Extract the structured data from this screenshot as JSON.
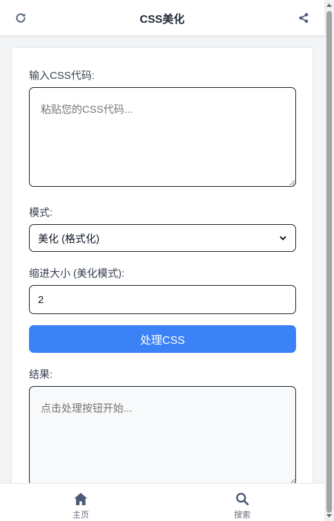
{
  "header": {
    "title": "CSS美化",
    "refresh_icon": "refresh-icon",
    "share_icon": "share-icon"
  },
  "form": {
    "input_label": "输入CSS代码:",
    "input_placeholder": "粘贴您的CSS代码...",
    "input_value": "",
    "mode_label": "模式:",
    "mode_selected": "美化 (格式化)",
    "indent_label": "缩进大小 (美化模式):",
    "indent_value": "2",
    "process_button": "处理CSS",
    "result_label": "结果:",
    "result_placeholder": "点击处理按钮开始..."
  },
  "bottom_nav": {
    "items": [
      {
        "label": "主页",
        "icon": "home-icon"
      },
      {
        "label": "搜索",
        "icon": "search-icon"
      }
    ]
  },
  "colors": {
    "accent": "#3b82f6",
    "nav_icon": "#4b5a77"
  }
}
